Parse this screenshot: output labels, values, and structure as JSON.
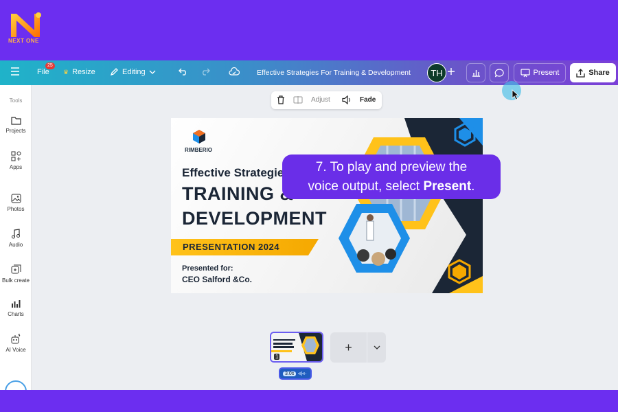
{
  "branding": {
    "logo_text": "NEXT ONE"
  },
  "toolbar": {
    "menu_icon": "hamburger-icon",
    "file_label": "File",
    "file_badge": "25",
    "resize_label": "Resize",
    "editing_label": "Editing",
    "document_title": "Effective Strategies For Training & Development",
    "avatar_initials": "TH",
    "present_label": "Present",
    "share_label": "Share"
  },
  "sidebar": {
    "tools_label": "Tools",
    "items": [
      {
        "label": "Projects",
        "icon": "folder-icon"
      },
      {
        "label": "Apps",
        "icon": "apps-icon"
      },
      {
        "label": "Photos",
        "icon": "image-icon"
      },
      {
        "label": "Audio",
        "icon": "music-note-icon"
      },
      {
        "label": "Bulk create",
        "icon": "bulk-create-icon"
      },
      {
        "label": "Charts",
        "icon": "chart-icon"
      },
      {
        "label": "AI Voice",
        "icon": "ai-voice-icon"
      }
    ]
  },
  "context_bar": {
    "adjust_label": "Adjust",
    "fade_label": "Fade"
  },
  "slide": {
    "brand": "RIMBERIO",
    "heading_small": "Effective Strategies",
    "heading_line1": "TRAINING &",
    "heading_line2": "DEVELOPMENT",
    "ribbon": "PRESENTATION 2024",
    "presented_for": "Presented for:",
    "client": "CEO Salford &Co.",
    "colors": {
      "navy": "#1b2636",
      "accent_yellow": "#ffc21a",
      "accent_blue": "#1e8fe8"
    }
  },
  "caption": {
    "line1": "7. To play and preview the",
    "line2_prefix": "voice output, select ",
    "line2_bold": "Present",
    "line2_suffix": "."
  },
  "pages": {
    "thumb_page_number": "1",
    "add_page_label": "+",
    "audio_duration": "3.0s"
  }
}
